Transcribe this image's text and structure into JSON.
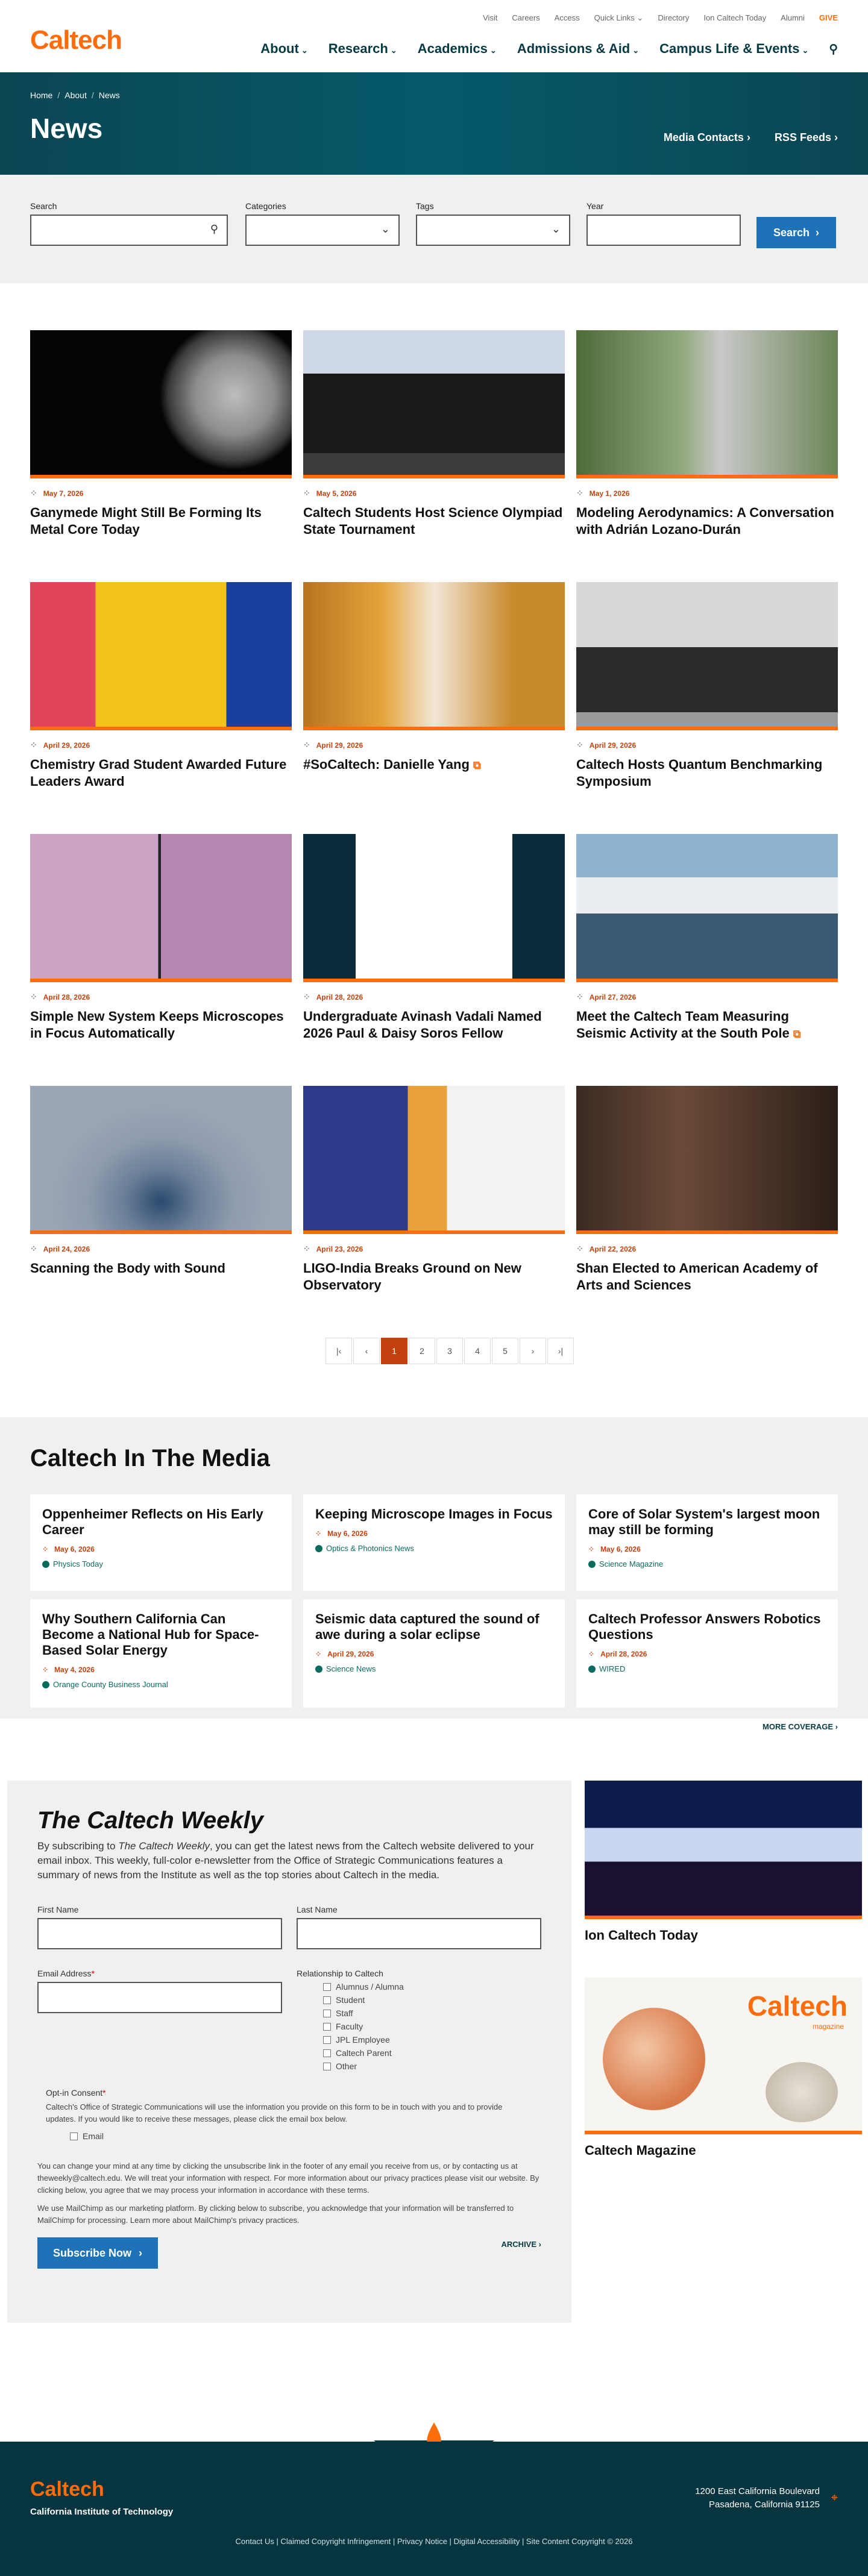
{
  "header": {
    "logo": "Caltech",
    "utility": [
      "Visit",
      "Careers",
      "Access",
      "Quick Links",
      "Directory",
      "Ion Caltech Today",
      "Alumni",
      "GIVE"
    ],
    "nav": [
      "About",
      "Research",
      "Academics",
      "Admissions & Aid",
      "Campus Life & Events"
    ]
  },
  "hero": {
    "breadcrumb": [
      "Home",
      "About",
      "News"
    ],
    "title": "News",
    "links": [
      "Media Contacts",
      "RSS Feeds"
    ]
  },
  "filters": {
    "labels": [
      "Search",
      "Categories",
      "Tags",
      "Year"
    ],
    "button": "Search"
  },
  "news": [
    {
      "date": "May 7, 2026",
      "title": "Ganymede Might Still Be Forming Its Metal Core Today",
      "ext": false
    },
    {
      "date": "May 5, 2026",
      "title": "Caltech Students Host Science Olympiad State Tournament",
      "ext": false
    },
    {
      "date": "May 1, 2026",
      "title": "Modeling Aerodynamics: A Conversation with Adrián Lozano-Durán",
      "ext": false
    },
    {
      "date": "April 29, 2026",
      "title": "Chemistry Grad Student Awarded Future Leaders Award",
      "ext": false
    },
    {
      "date": "April 29, 2026",
      "title": "#SoCaltech: Danielle Yang",
      "ext": true
    },
    {
      "date": "April 29, 2026",
      "title": "Caltech Hosts Quantum Benchmarking Symposium",
      "ext": false
    },
    {
      "date": "April 28, 2026",
      "title": "Simple New System Keeps Microscopes in Focus Automatically",
      "ext": false
    },
    {
      "date": "April 28, 2026",
      "title": "Undergraduate Avinash Vadali Named 2026 Paul & Daisy Soros Fellow",
      "ext": false
    },
    {
      "date": "April 27, 2026",
      "title": "Meet the Caltech Team Measuring Seismic Activity at the South Pole",
      "ext": true
    },
    {
      "date": "April 24, 2026",
      "title": "Scanning the Body with Sound",
      "ext": false
    },
    {
      "date": "April 23, 2026",
      "title": "LIGO-India Breaks Ground on New Observatory",
      "ext": false
    },
    {
      "date": "April 22, 2026",
      "title": "Shan Elected to American Academy of Arts and Sciences",
      "ext": false
    }
  ],
  "pagination": [
    "|‹",
    "‹",
    "1",
    "2",
    "3",
    "4",
    "5",
    "›",
    "›|"
  ],
  "media": {
    "title": "Caltech In The Media",
    "items": [
      {
        "title": "Oppenheimer Reflects on His Early Career",
        "date": "May 6, 2026",
        "source": "Physics Today"
      },
      {
        "title": "Keeping Microscope Images in Focus",
        "date": "May 6, 2026",
        "source": "Optics & Photonics News"
      },
      {
        "title": "Core of Solar System's largest moon may still be forming",
        "date": "May 6, 2026",
        "source": "Science Magazine"
      },
      {
        "title": "Why Southern California Can Become a National Hub for Space-Based Solar Energy",
        "date": "May 4, 2026",
        "source": "Orange County Business Journal"
      },
      {
        "title": "Seismic data captured the sound of awe during a solar eclipse",
        "date": "April 29, 2026",
        "source": "Science News"
      },
      {
        "title": "Caltech Professor Answers Robotics Questions",
        "date": "April 28, 2026",
        "source": "WIRED"
      }
    ],
    "more": "MORE COVERAGE"
  },
  "weekly": {
    "title": "The Caltech Weekly",
    "intro_pre": "By subscribing to ",
    "intro_em": "The Caltech Weekly",
    "intro_post": ", you can get the latest news from the Caltech website delivered to your email inbox. This weekly, full-color e-newsletter from the Office of Strategic Communications features a summary of news from the Institute as well as the top stories about Caltech in the media.",
    "first": "First Name",
    "last": "Last Name",
    "email": "Email Address",
    "relationship": "Relationship to Caltech",
    "options": [
      "Alumnus / Alumna",
      "Student",
      "Staff",
      "Faculty",
      "JPL Employee",
      "Caltech Parent",
      "Other"
    ],
    "optin": "Opt-in Consent",
    "optin_text": "Caltech's Office of Strategic Communications will use the information you provide on this form to be in touch with you and to provide updates. If you would like to receive these messages, please click the email box below.",
    "optin_email": "Email",
    "p1": "You can change your mind at any time by clicking the unsubscribe link in the footer of any email you receive from us, or by contacting us at theweekly@caltech.edu. We will treat your information with respect. For more information about our privacy practices please visit our website. By clicking below, you agree that we may process your information in accordance with these terms.",
    "p2": "We use MailChimp as our marketing platform. By clicking below to subscribe, you acknowledge that your information will be transferred to MailChimp for processing. Learn more about MailChimp's privacy practices.",
    "subscribe": "Subscribe Now",
    "archive": "ARCHIVE"
  },
  "side": {
    "ion": "Ion Caltech Today",
    "mag": "Caltech Magazine",
    "mag_logo": "Caltech",
    "mag_sub": "magazine"
  },
  "footer": {
    "logo": "Caltech",
    "name": "California Institute of Technology",
    "addr1": "1200 East California Boulevard",
    "addr2": "Pasadena, California 91125",
    "links": "Contact Us  |  Claimed Copyright Infringement  |  Privacy Notice  |  Digital Accessibility  |  Site Content Copyright © 2026"
  },
  "colors": {
    "orange": "#ff6c0c",
    "teal": "#065a6b",
    "blue": "#1e73b8"
  }
}
